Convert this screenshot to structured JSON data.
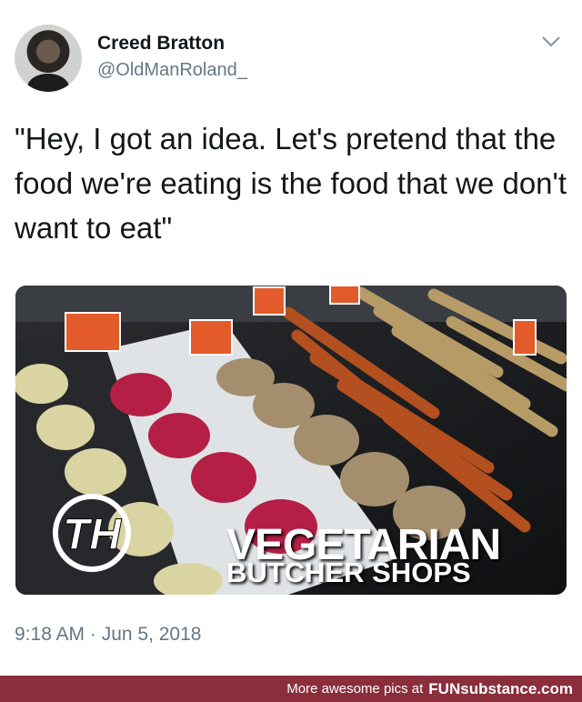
{
  "tweet": {
    "display_name": "Creed Bratton",
    "handle": "@OldManRoland_",
    "text": "\"Hey, I got an idea. Let's pretend that the food we're eating is the food that we don't want to eat\"",
    "timestamp": "9:18 AM · Jun 5, 2018",
    "menu_icon": "chevron-down-icon"
  },
  "media": {
    "overlay_logo": "TH",
    "overlay_title": "VEGETARIAN",
    "overlay_subtitle": "BUTCHER SHOPS"
  },
  "footer": {
    "prefix": "More awesome pics at",
    "brand": "FUNsubstance.com",
    "background": "#8a2e3b"
  }
}
